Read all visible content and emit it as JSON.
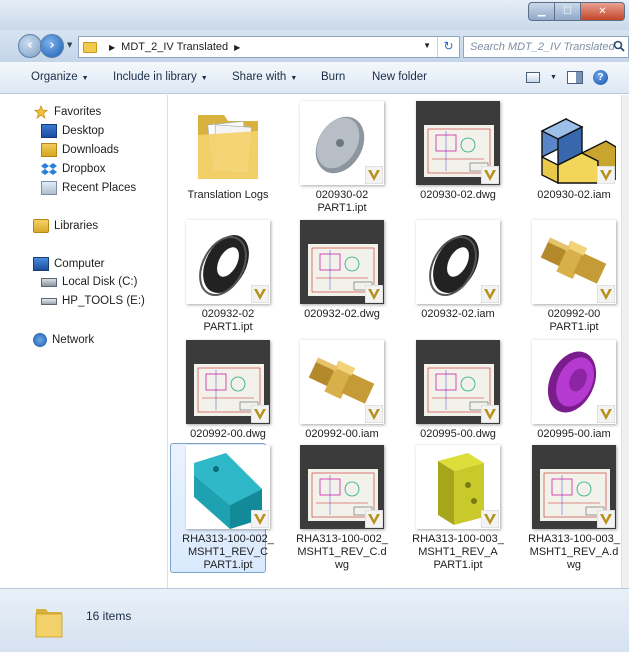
{
  "window": {
    "controls": {
      "minimize": "▁",
      "maximize": "☐",
      "close": "✕"
    }
  },
  "address": {
    "crumbs": [
      "MDT_2_IV Translated"
    ],
    "search_placeholder": "Search MDT_2_IV Translated"
  },
  "toolbar": {
    "organize": "Organize",
    "include_in_library": "Include in library",
    "share_with": "Share with",
    "burn": "Burn",
    "new_folder": "New folder",
    "help": "?"
  },
  "nav": {
    "favorites": {
      "label": "Favorites",
      "items": [
        "Desktop",
        "Downloads",
        "Dropbox",
        "Recent Places"
      ]
    },
    "libraries": "Libraries",
    "computer": {
      "label": "Computer",
      "items": [
        "Local Disk (C:)",
        "HP_TOOLS (E:)"
      ]
    },
    "network": "Network"
  },
  "files": [
    {
      "name": "Translation Logs",
      "kind": "folder"
    },
    {
      "name": "020930-02\nPART1.ipt",
      "kind": "disc-grey"
    },
    {
      "name": "020930-02.dwg",
      "kind": "dwg"
    },
    {
      "name": "020930-02.iam",
      "kind": "iam-cubes"
    },
    {
      "name": "020932-02\nPART1.ipt",
      "kind": "washer"
    },
    {
      "name": "020932-02.dwg",
      "kind": "dwg"
    },
    {
      "name": "020932-02.iam",
      "kind": "washer"
    },
    {
      "name": "020992-00\nPART1.ipt",
      "kind": "fitting"
    },
    {
      "name": "020992-00.dwg",
      "kind": "dwg"
    },
    {
      "name": "020992-00.iam",
      "kind": "fitting"
    },
    {
      "name": "020995-00.dwg",
      "kind": "dwg"
    },
    {
      "name": "020995-00.iam",
      "kind": "pulley"
    },
    {
      "name": "RHA313-100-002_\nMSHT1_REV_C\nPART1.ipt",
      "kind": "teal-block"
    },
    {
      "name": "RHA313-100-002_\nMSHT1_REV_C.d\nwg",
      "kind": "dwg"
    },
    {
      "name": "RHA313-100-003_\nMSHT1_REV_A\nPART1.ipt",
      "kind": "yellow-block"
    },
    {
      "name": "RHA313-100-003_\nMSHT1_REV_A.d\nwg",
      "kind": "dwg"
    }
  ],
  "status": {
    "count": "16 items"
  },
  "colors": {
    "accent": "#1a5fb4",
    "selection": "#c1dbfc",
    "chrome": "#d7e4f2"
  }
}
